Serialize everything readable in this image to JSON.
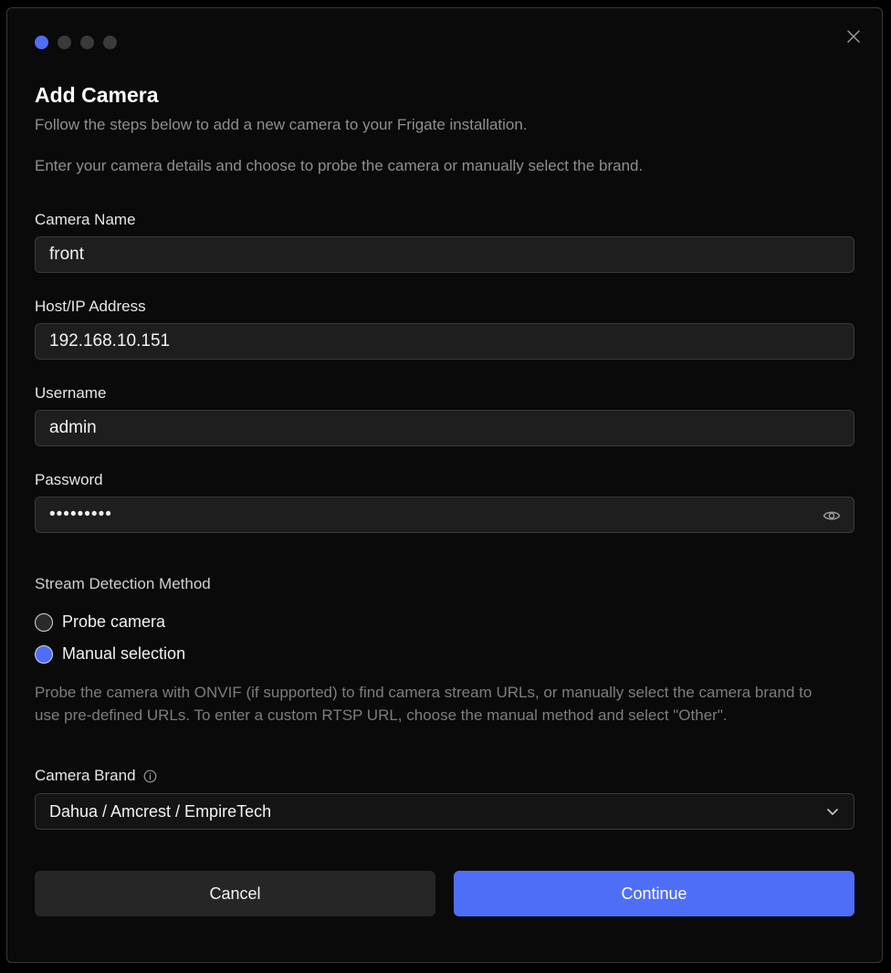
{
  "dialog": {
    "title": "Add Camera",
    "subtitle": "Follow the steps below to add a new camera to your Frigate installation.",
    "intro": "Enter your camera details and choose to probe the camera or manually select the brand.",
    "steps": {
      "total": 4,
      "current": 1
    }
  },
  "fields": {
    "camera_name": {
      "label": "Camera Name",
      "value": "front"
    },
    "host": {
      "label": "Host/IP Address",
      "value": "192.168.10.151"
    },
    "username": {
      "label": "Username",
      "value": "admin"
    },
    "password": {
      "label": "Password",
      "value": "•••••••••"
    }
  },
  "detection": {
    "label": "Stream Detection Method",
    "options": [
      {
        "label": "Probe camera",
        "checked": false
      },
      {
        "label": "Manual selection",
        "checked": true
      }
    ],
    "help": "Probe the camera with ONVIF (if supported) to find camera stream URLs, or manually select the camera brand to use pre-defined URLs. To enter a custom RTSP URL, choose the manual method and select \"Other\"."
  },
  "brand": {
    "label": "Camera Brand",
    "selected": "Dahua / Amcrest / EmpireTech"
  },
  "buttons": {
    "cancel": "Cancel",
    "continue": "Continue"
  },
  "colors": {
    "accent": "#4f6ef7",
    "background": "#0a0a0a",
    "input": "#1e1e1e"
  },
  "icons": [
    "close-icon",
    "eye-icon",
    "info-icon",
    "chevron-down-icon"
  ]
}
